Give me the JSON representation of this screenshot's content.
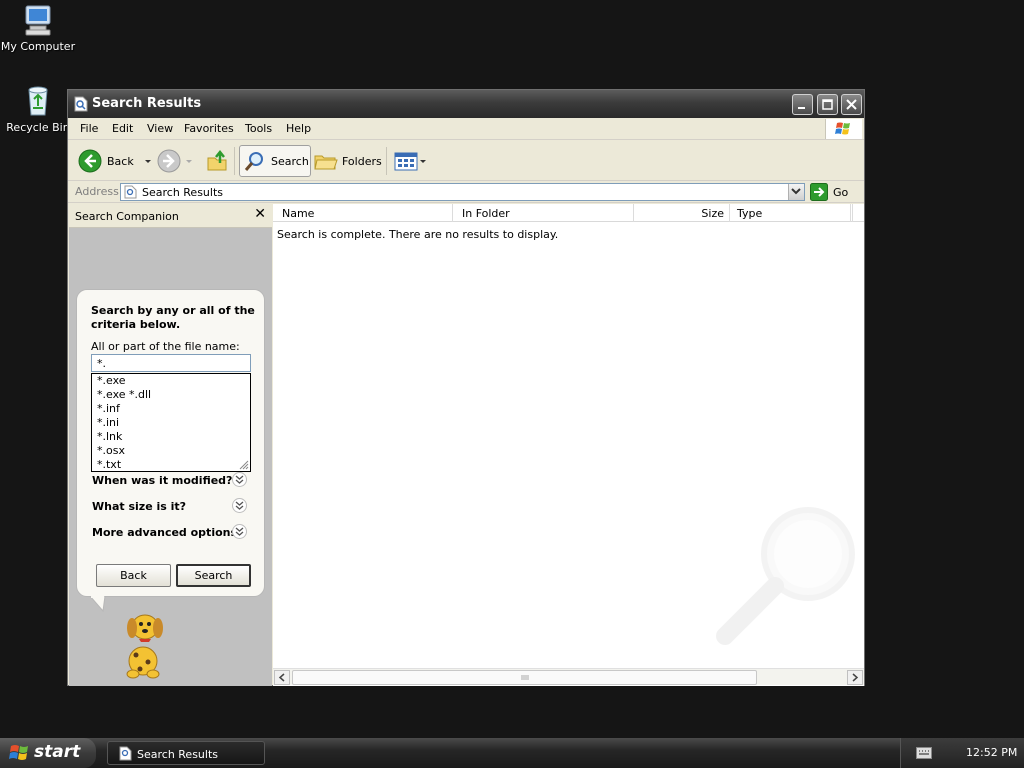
{
  "desktop": {
    "icons": [
      {
        "label": "My Computer"
      },
      {
        "label": "Recycle Bin"
      }
    ]
  },
  "window": {
    "title": "Search Results",
    "menu": [
      "File",
      "Edit",
      "View",
      "Favorites",
      "Tools",
      "Help"
    ],
    "toolbar": {
      "back": "Back",
      "search": "Search",
      "folders": "Folders"
    },
    "address": {
      "label": "Address",
      "value": "Search Results",
      "go": "Go"
    }
  },
  "search_companion": {
    "title": "Search Companion",
    "heading": "Search by any or all of the criteria below.",
    "filename_label": "All or part of the file name:",
    "filename_value": "*.",
    "suggestions": [
      "*.exe",
      "*.exe *.dll",
      "*.inf",
      "*.ini",
      "*.lnk",
      "*.osx",
      "*.txt"
    ],
    "options": [
      "When was it modified?",
      "What size is it?",
      "More advanced options"
    ],
    "back_button": "Back",
    "search_button": "Search"
  },
  "results": {
    "columns": [
      "Name",
      "In Folder",
      "Size",
      "Type"
    ],
    "message": "Search is complete. There are no results to display."
  },
  "taskbar": {
    "start": "start",
    "task": "Search Results",
    "clock": "12:52 PM"
  },
  "colors": {
    "title_bar": "#3b3b3b",
    "desktop": "#151515",
    "pane_gray": "#c0c0c0",
    "back_arrow": "#2e9b2e"
  }
}
